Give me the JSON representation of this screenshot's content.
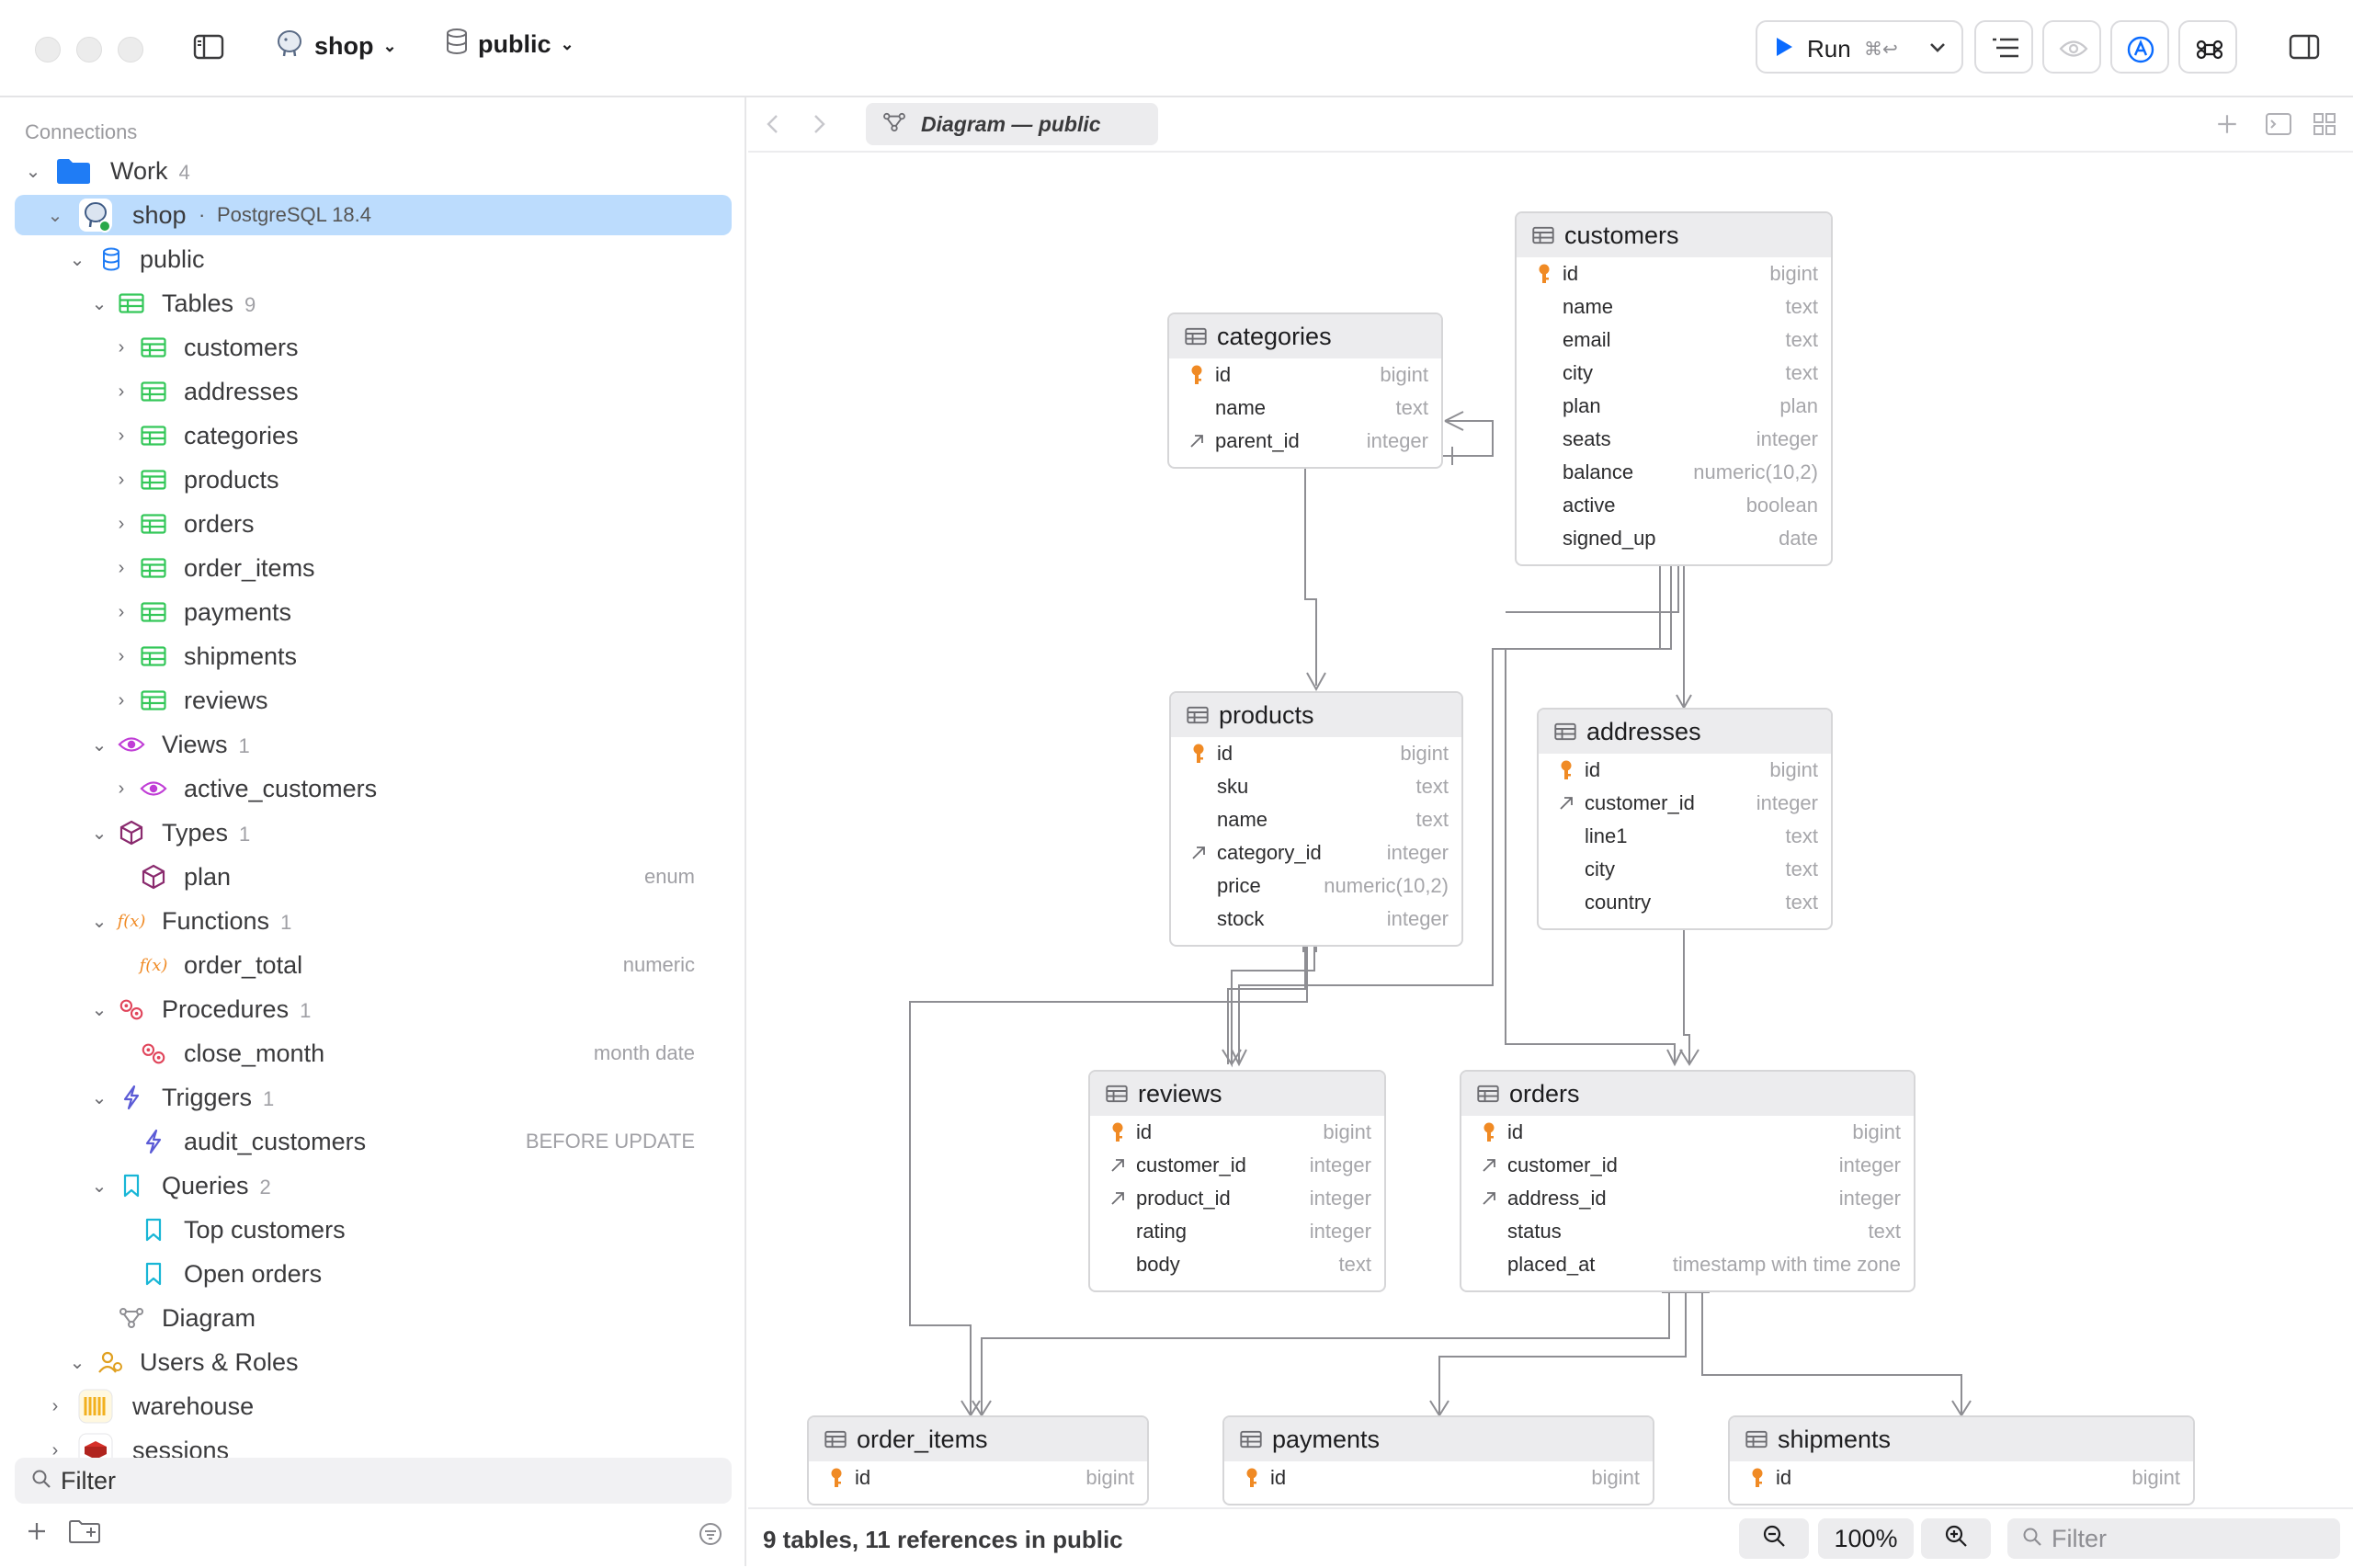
{
  "toolbar": {
    "connection": "shop",
    "schema": "public",
    "run_label": "Run",
    "run_shortcut": "⌘↩"
  },
  "sidebar": {
    "section_label": "Connections",
    "group": {
      "label": "Work",
      "count": "4"
    },
    "connection": {
      "label": "shop",
      "detail": "PostgreSQL 18.4"
    },
    "schema": "public",
    "tables_label": "Tables",
    "tables_count": "9",
    "tables": [
      "customers",
      "addresses",
      "categories",
      "products",
      "orders",
      "order_items",
      "payments",
      "shipments",
      "reviews"
    ],
    "views_label": "Views",
    "views_count": "1",
    "view": "active_customers",
    "types_label": "Types",
    "types_count": "1",
    "type": {
      "name": "plan",
      "detail": "enum"
    },
    "functions_label": "Functions",
    "functions_count": "1",
    "function": {
      "name": "order_total",
      "detail": "numeric"
    },
    "procedures_label": "Procedures",
    "procedures_count": "1",
    "procedure": {
      "name": "close_month",
      "detail": "month date"
    },
    "triggers_label": "Triggers",
    "triggers_count": "1",
    "trigger": {
      "name": "audit_customers",
      "detail": "BEFORE UPDATE"
    },
    "queries_label": "Queries",
    "queries_count": "2",
    "queries": [
      "Top customers",
      "Open orders"
    ],
    "diagram_label": "Diagram",
    "users_label": "Users & Roles",
    "other_connections": [
      "warehouse",
      "sessions"
    ],
    "filter_placeholder": "Filter"
  },
  "tab": {
    "title": "Diagram — public"
  },
  "diagram": {
    "tables": [
      {
        "name": "customers",
        "columns": [
          [
            "id",
            "bigint",
            "pk"
          ],
          [
            "name",
            "text",
            ""
          ],
          [
            "email",
            "text",
            ""
          ],
          [
            "city",
            "text",
            ""
          ],
          [
            "plan",
            "plan",
            ""
          ],
          [
            "seats",
            "integer",
            ""
          ],
          [
            "balance",
            "numeric(10,2)",
            ""
          ],
          [
            "active",
            "boolean",
            ""
          ],
          [
            "signed_up",
            "date",
            ""
          ]
        ]
      },
      {
        "name": "categories",
        "columns": [
          [
            "id",
            "bigint",
            "pk"
          ],
          [
            "name",
            "text",
            ""
          ],
          [
            "parent_id",
            "integer",
            "fk"
          ]
        ]
      },
      {
        "name": "products",
        "columns": [
          [
            "id",
            "bigint",
            "pk"
          ],
          [
            "sku",
            "text",
            ""
          ],
          [
            "name",
            "text",
            ""
          ],
          [
            "category_id",
            "integer",
            "fk"
          ],
          [
            "price",
            "numeric(10,2)",
            ""
          ],
          [
            "stock",
            "integer",
            ""
          ]
        ]
      },
      {
        "name": "addresses",
        "columns": [
          [
            "id",
            "bigint",
            "pk"
          ],
          [
            "customer_id",
            "integer",
            "fk"
          ],
          [
            "line1",
            "text",
            ""
          ],
          [
            "city",
            "text",
            ""
          ],
          [
            "country",
            "text",
            ""
          ]
        ]
      },
      {
        "name": "reviews",
        "columns": [
          [
            "id",
            "bigint",
            "pk"
          ],
          [
            "customer_id",
            "integer",
            "fk"
          ],
          [
            "product_id",
            "integer",
            "fk"
          ],
          [
            "rating",
            "integer",
            ""
          ],
          [
            "body",
            "text",
            ""
          ]
        ]
      },
      {
        "name": "orders",
        "columns": [
          [
            "id",
            "bigint",
            "pk"
          ],
          [
            "customer_id",
            "integer",
            "fk"
          ],
          [
            "address_id",
            "integer",
            "fk"
          ],
          [
            "status",
            "text",
            ""
          ],
          [
            "placed_at",
            "timestamp with time zone",
            ""
          ]
        ]
      },
      {
        "name": "order_items",
        "columns": [
          [
            "id",
            "bigint",
            "pk"
          ]
        ]
      },
      {
        "name": "payments",
        "columns": [
          [
            "id",
            "bigint",
            "pk"
          ]
        ]
      },
      {
        "name": "shipments",
        "columns": [
          [
            "id",
            "bigint",
            "pk"
          ]
        ]
      }
    ]
  },
  "status": {
    "summary": "9 tables, 11 references in public",
    "zoom": "100%",
    "filter_placeholder": "Filter"
  },
  "colors": {
    "accent": "#0a6bff",
    "selection": "#bcdcfd",
    "pk_key": "#f08a24",
    "table_icon": "#34c759",
    "view_icon": "#c03dd6",
    "type_icon": "#8a2a6e",
    "function_icon": "#f08a24",
    "procedure_icon": "#e0445a",
    "trigger_icon": "#5b5bd6",
    "query_icon": "#18b6d6"
  }
}
